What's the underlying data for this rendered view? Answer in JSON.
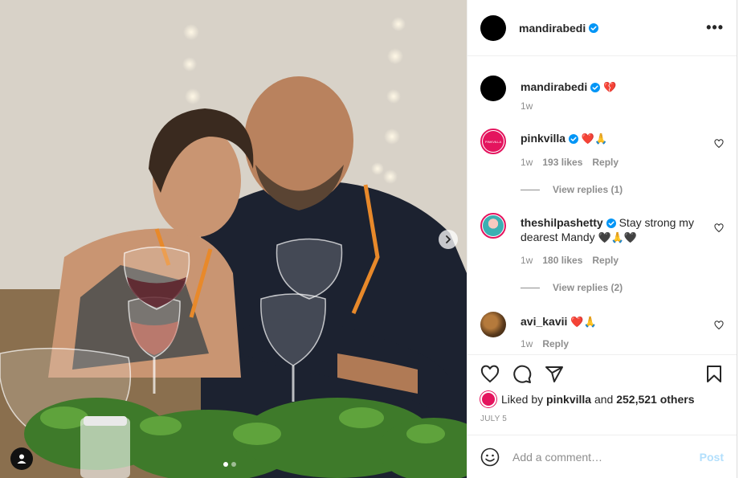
{
  "header": {
    "username": "mandirabedi"
  },
  "caption": {
    "username": "mandirabedi",
    "emoji": "💔",
    "time": "1w"
  },
  "comments": [
    {
      "username": "pinkvilla",
      "text": "",
      "emoji": "❤️🙏",
      "time": "1w",
      "likes": "193 likes",
      "reply": "Reply",
      "view_replies": "View replies (1)"
    },
    {
      "username": "theshilpashetty",
      "text": "Stay strong my dearest Mandy",
      "emoji": "🖤🙏🖤",
      "time": "1w",
      "likes": "180 likes",
      "reply": "Reply",
      "view_replies": "View replies (2)"
    },
    {
      "username": "avi_kavii",
      "text": "",
      "emoji": "❤️🙏",
      "time": "1w",
      "reply": "Reply"
    }
  ],
  "likes": {
    "prefix": "Liked by",
    "user": "pinkvilla",
    "and": "and",
    "count": "252,521 others"
  },
  "date": "JULY 5",
  "add_comment": {
    "placeholder": "Add a comment…",
    "post": "Post"
  },
  "carousel": {
    "slides": 2,
    "active": 1
  },
  "colors": {
    "verified": "#0095f6",
    "link": "#b2dffc",
    "brand_pink": "#e4145e"
  }
}
